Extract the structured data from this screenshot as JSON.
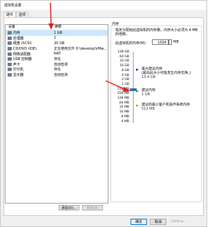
{
  "window": {
    "title": "虚拟机设置"
  },
  "tabs": [
    {
      "label": "硬件",
      "active": true
    },
    {
      "label": "选项",
      "active": false
    }
  ],
  "device_list": {
    "headers": {
      "device": "设备",
      "summary": "摘要"
    },
    "rows": [
      {
        "name": "内存",
        "summary": "1 GB",
        "icon": "memory-icon",
        "selected": true
      },
      {
        "name": "处理器",
        "summary": "1",
        "icon": "cpu-icon"
      },
      {
        "name": "硬盘 (SCSI)",
        "summary": "20 GB",
        "icon": "disk-icon"
      },
      {
        "name": "CD/DVD (IDE)",
        "summary": "正在使用文件 D:\\develop\\VMw...",
        "icon": "cd-icon"
      },
      {
        "name": "网络适配器",
        "summary": "NAT",
        "icon": "network-icon"
      },
      {
        "name": "USB 控制器",
        "summary": "存在",
        "icon": "usb-icon"
      },
      {
        "name": "声卡",
        "summary": "自动检测",
        "icon": "sound-icon"
      },
      {
        "name": "打印机",
        "summary": "存在",
        "icon": "printer-icon"
      },
      {
        "name": "显示器",
        "summary": "自动检测",
        "icon": "monitor-icon"
      }
    ],
    "add_label": "添加(D)...",
    "remove_label": "移除(R)"
  },
  "memory": {
    "group_label": "内存",
    "description": "指定分配给此虚拟机的内存量。内存大小必须为 4 MB 的倍数。",
    "field_label": "此虚拟机的内存(M):",
    "value": "1024",
    "unit": "MB",
    "scale": [
      "128 GB",
      "64 GB",
      "32 GB",
      "16 GB",
      "8 GB",
      "4 GB",
      "2 GB",
      "1 GB",
      "512 MB",
      "256 MB",
      "128 MB",
      "64 MB",
      "32 MB",
      "16 MB",
      "8 MB",
      "4 MB"
    ],
    "slider_value": "1 GB",
    "legend": {
      "max_recommended": {
        "label": "最大建议内存",
        "note": "(超出此大小可能发生内存交换。)",
        "value": "13.4 GB",
        "color": "#1f4e9a"
      },
      "recommended": {
        "label": "建议内存",
        "value": "1 GB",
        "color": "#2ea64a"
      },
      "min_recommended": {
        "label": "建议的最小客户机操作系统内存",
        "value": "512 MB",
        "color": "#d4a20b"
      }
    }
  },
  "footer": {
    "ok_label": "确定",
    "cancel_label": "取消",
    "watermark": "CSDN @..."
  },
  "colors": {
    "accent": "#0078d7",
    "annotation_arrow": "#e02020",
    "selection": "#cce8ff"
  }
}
